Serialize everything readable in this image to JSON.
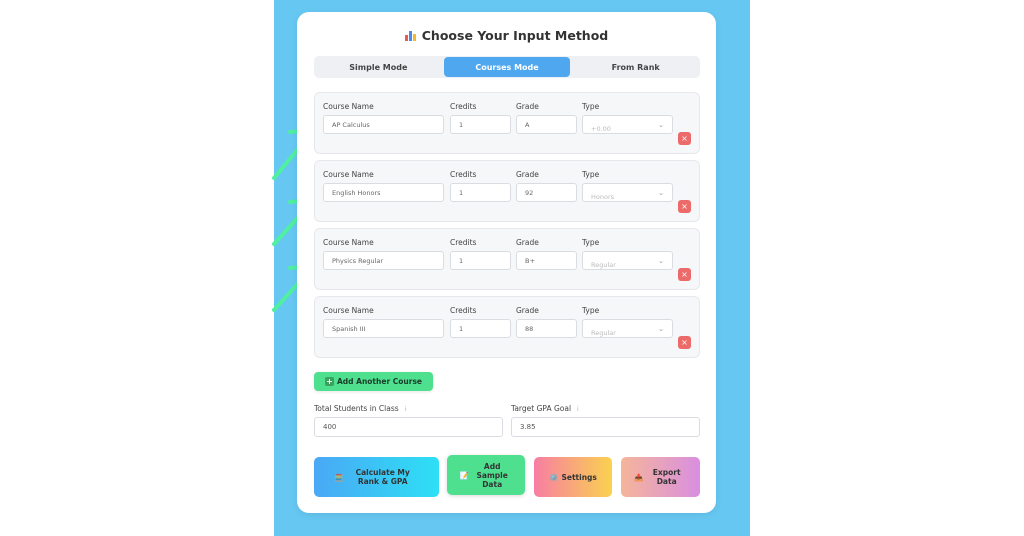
{
  "title": "Choose Your Input Method",
  "modes": [
    "Simple Mode",
    "Courses Mode",
    "From Rank"
  ],
  "active_mode": "Courses Mode",
  "labels": {
    "course_name": "Course Name",
    "credits": "Credits",
    "grade": "Grade",
    "type": "Type"
  },
  "courses": [
    {
      "name": "AP Calculus",
      "credits": "1",
      "grade": "A",
      "type": "+0.00"
    },
    {
      "name": "English Honors",
      "credits": "1",
      "grade": "92",
      "type": "Honors"
    },
    {
      "name": "Physics Regular",
      "credits": "1",
      "grade": "B+",
      "type": "Regular"
    },
    {
      "name": "Spanish III",
      "credits": "1",
      "grade": "88",
      "type": "Regular"
    }
  ],
  "delete_label": "×",
  "add_course_label": "Add Another Course",
  "add_course_icon": "➕",
  "total_students_label": "Total Students in Class",
  "total_students_value": "400",
  "target_gpa_label": "Target GPA Goal",
  "target_gpa_value": "3.85",
  "info_icon": "i",
  "actions": {
    "calculate": "Calculate My Rank & GPA",
    "sample": "Add Sample Data",
    "settings": "Settings",
    "export": "Export Data"
  },
  "icons": {
    "calculate": "🧮",
    "sample": "📝",
    "settings": "⚙️",
    "export": "📤"
  },
  "colors": {
    "background": "#66c8f2",
    "active_mode": "#4ea7ef",
    "add_course": "#4ee08f",
    "delete": "#ec6a6a",
    "arrow": "#4ff0a0"
  }
}
